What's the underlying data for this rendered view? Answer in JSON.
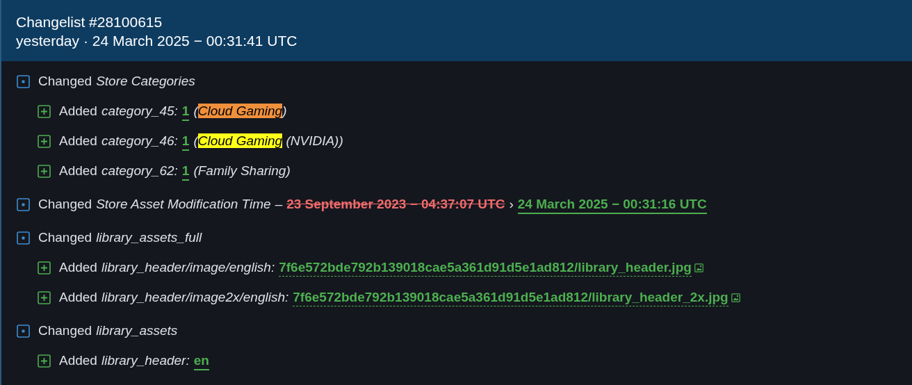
{
  "header": {
    "title": "Changelist #28100615",
    "subtitle": "yesterday · 24 March 2025 − 00:31:41 UTC"
  },
  "changes": [
    {
      "kind": "changed",
      "verb": "Changed",
      "key": "Store Categories",
      "children": [
        {
          "kind": "added",
          "verb": "Added",
          "key": "category_45:",
          "value": {
            "text": "1",
            "kind": "solid"
          },
          "note": [
            {
              "text": "("
            },
            {
              "text": "Cloud Gaming",
              "color": "#f0903c"
            },
            {
              "text": ")"
            }
          ]
        },
        {
          "kind": "added",
          "verb": "Added",
          "key": "category_46:",
          "value": {
            "text": "1",
            "kind": "solid"
          },
          "note": [
            {
              "text": "("
            },
            {
              "text": "Cloud Gaming",
              "color": "#ffff1a"
            },
            {
              "text": " (NVIDIA))"
            }
          ]
        },
        {
          "kind": "added",
          "verb": "Added",
          "key": "category_62:",
          "value": {
            "text": "1",
            "kind": "solid"
          },
          "note": [
            {
              "text": "(Family Sharing)"
            }
          ]
        }
      ]
    },
    {
      "kind": "changed",
      "verb": "Changed",
      "key": "Store Asset Modification Time",
      "dash": "–",
      "old": "23 September 2023 − 04:37:07 UTC",
      "arrow": "›",
      "value": {
        "text": "24 March 2025 − 00:31:16 UTC",
        "kind": "solid"
      }
    },
    {
      "kind": "changed",
      "verb": "Changed",
      "key": "library_assets_full",
      "children": [
        {
          "kind": "added",
          "verb": "Added",
          "key": "library_header/image/english:",
          "value": {
            "text": "7f6e572bde792b139018cae5a361d91d5e1ad812/library_header.jpg",
            "kind": "link"
          }
        },
        {
          "kind": "added",
          "verb": "Added",
          "key": "library_header/image2x/english:",
          "value": {
            "text": "7f6e572bde792b139018cae5a361d91d5e1ad812/library_header_2x.jpg",
            "kind": "link"
          }
        }
      ]
    },
    {
      "kind": "changed",
      "verb": "Changed",
      "key": "library_assets",
      "children": [
        {
          "kind": "added",
          "verb": "Added",
          "key": "library_header:",
          "value": {
            "text": "en",
            "kind": "solid"
          }
        }
      ]
    }
  ]
}
